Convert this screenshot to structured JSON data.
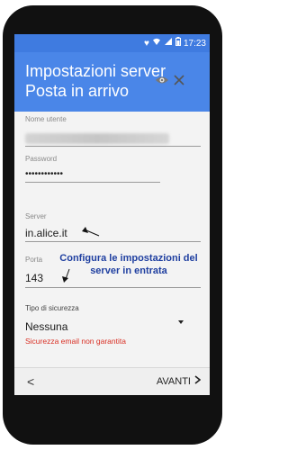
{
  "status_bar": {
    "time": "17:23",
    "icons": [
      "heart-icon",
      "wifi-icon",
      "signal-icon",
      "battery-icon"
    ]
  },
  "header": {
    "title_line1": "Impostazioni server",
    "title_line2": "Posta in arrivo"
  },
  "form": {
    "username_label": "Nome utente",
    "password_label": "Password",
    "password_value": "••••••••••••",
    "server_label": "Server",
    "server_value": "in.alice.it",
    "port_label": "Porta",
    "port_value": "143",
    "security_label": "Tipo di sicurezza",
    "security_value": "Nessuna",
    "security_warning": "Sicurezza email non garantita"
  },
  "annotation": {
    "line1": "Configura le impostazioni del",
    "line2": "server in entrata"
  },
  "footer": {
    "back_symbol": "<",
    "next_label": "AVANTI"
  },
  "colors": {
    "header": "#4a86e8",
    "status_bar": "#3f7be0",
    "annotation": "#1f3fa0",
    "warning": "#d93025"
  }
}
